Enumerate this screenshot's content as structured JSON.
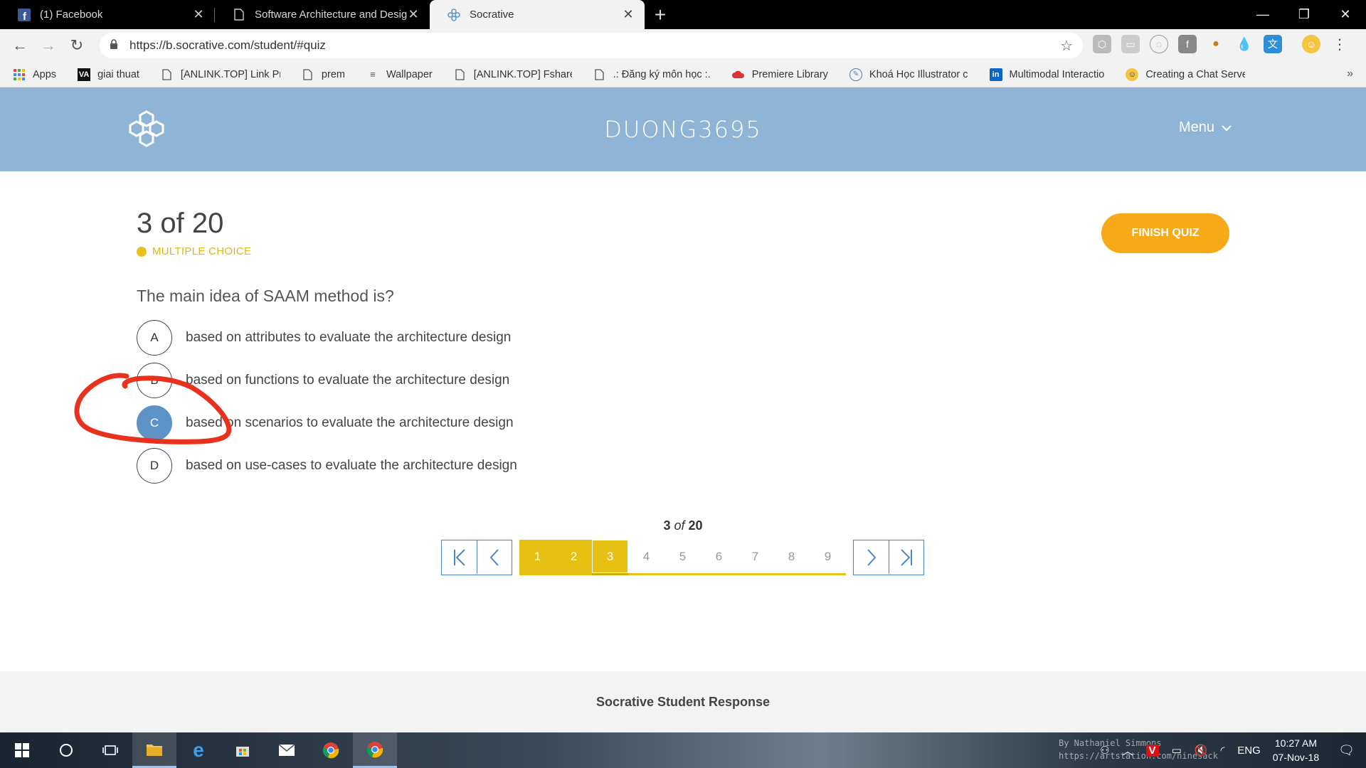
{
  "browser": {
    "tabs": [
      {
        "title": "(1) Facebook",
        "icon": "facebook-icon",
        "active": false
      },
      {
        "title": "Software Architecture and Design",
        "icon": "page-icon",
        "active": false
      },
      {
        "title": "Socrative",
        "icon": "socrative-icon",
        "active": true
      }
    ],
    "new_tab_label": "+",
    "url": "https://b.socrative.com/student/#quiz",
    "bookmarks": [
      {
        "label": "Apps",
        "icon": "apps-grid-icon"
      },
      {
        "label": "giai thuat",
        "icon": "va-icon"
      },
      {
        "label": "[ANLINK.TOP] Link Pr",
        "icon": "page-icon"
      },
      {
        "label": "prem",
        "icon": "page-icon"
      },
      {
        "label": "Wallpaper",
        "icon": "layers-icon"
      },
      {
        "label": "[ANLINK.TOP] Fshare",
        "icon": "page-icon"
      },
      {
        "label": ".: Đăng ký môn học :.",
        "icon": "page-icon"
      },
      {
        "label": "Premiere Library",
        "icon": "cloud-icon"
      },
      {
        "label": "Khoá Học Illustrator c",
        "icon": "globe-icon"
      },
      {
        "label": "Multimodal Interactio",
        "icon": "linkedin-icon"
      },
      {
        "label": "Creating a Chat Serve",
        "icon": "avatar-icon"
      }
    ],
    "bookmarks_more": "»"
  },
  "header": {
    "room_name": "DUONG3695",
    "menu_label": "Menu"
  },
  "quiz": {
    "progress": "3 of 20",
    "question_type": "MULTIPLE CHOICE",
    "finish_label": "FINISH QUIZ",
    "question": "The main idea of SAAM method is?",
    "answers": [
      {
        "letter": "A",
        "text": "based on attributes to evaluate the architecture design",
        "selected": false
      },
      {
        "letter": "B",
        "text": "based on functions to evaluate the architecture design",
        "selected": false
      },
      {
        "letter": "C",
        "text": "based on scenarios to evaluate the architecture design",
        "selected": true
      },
      {
        "letter": "D",
        "text": "based on use-cases to evaluate the architecture design",
        "selected": false
      }
    ]
  },
  "pager": {
    "current": "3",
    "of_label": "of",
    "total": "20",
    "pages": [
      "1",
      "2",
      "3",
      "4",
      "5",
      "6",
      "7",
      "8",
      "9"
    ],
    "answered_through": 3
  },
  "footer": {
    "text": "Socrative Student Response"
  },
  "taskbar": {
    "language": "ENG",
    "time": "10:27 AM",
    "date": "07-Nov-18",
    "watermark_line1": "By Nathaniel Simmons",
    "watermark_line2": "https://artstation.com/ninesack"
  },
  "colors": {
    "header_bg": "#8fb4d6",
    "accent_yellow": "#e6c012",
    "finish_orange": "#f8a917",
    "selected_blue": "#5d93c6",
    "annotation_red": "#e8321e"
  }
}
